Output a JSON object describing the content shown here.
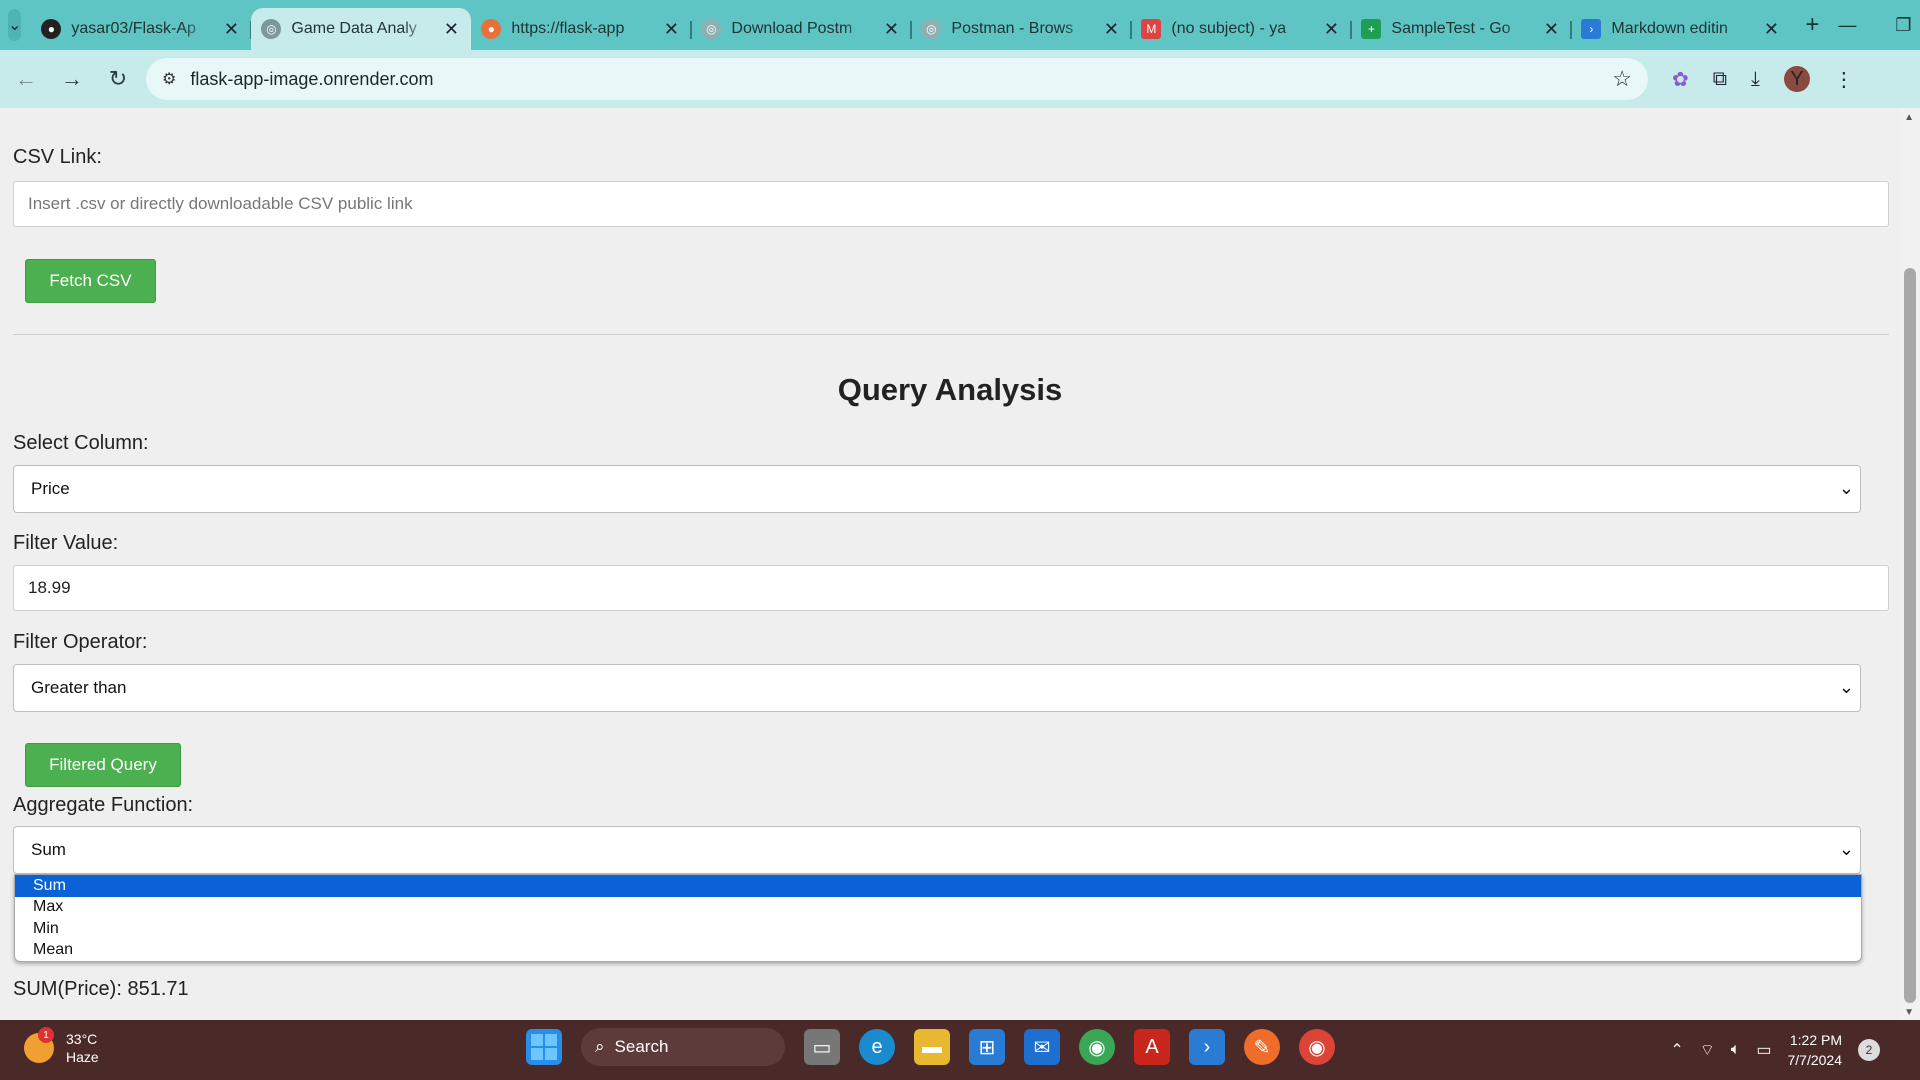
{
  "browser": {
    "tabs": [
      {
        "label": "yasar03/Flask-Ap",
        "icon": "github-icon",
        "active": false
      },
      {
        "label": "Game Data Analy",
        "icon": "globe-icon",
        "active": true
      },
      {
        "label": "https://flask-app",
        "icon": "render-icon",
        "active": false
      },
      {
        "label": "Download Postm",
        "icon": "postman-icon",
        "active": false
      },
      {
        "label": "Postman - Brows",
        "icon": "postman-icon",
        "active": false
      },
      {
        "label": "(no subject) - ya",
        "icon": "gmail-icon",
        "active": false
      },
      {
        "label": "SampleTest - Go",
        "icon": "sheets-icon",
        "active": false
      },
      {
        "label": "Markdown editin",
        "icon": "vscode-icon",
        "active": false
      }
    ],
    "url": "flask-app-image.onrender.com",
    "profile_initial": "Y"
  },
  "page": {
    "csv_label": "CSV Link:",
    "csv_placeholder": "Insert .csv or directly downloadable CSV public link",
    "fetch_button": "Fetch CSV",
    "section_title": "Query Analysis",
    "select_column_label": "Select Column:",
    "select_column_value": "Price",
    "filter_value_label": "Filter Value:",
    "filter_value": "18.99",
    "filter_operator_label": "Filter Operator:",
    "filter_operator_value": "Greater than",
    "filtered_query_button": "Filtered Query",
    "aggregate_label": "Aggregate Function:",
    "aggregate_value": "Sum",
    "aggregate_options": [
      "Sum",
      "Max",
      "Min",
      "Mean"
    ],
    "result": "SUM(Price): 851.71"
  },
  "taskbar": {
    "weather_temp": "33°C",
    "weather_desc": "Haze",
    "weather_badge": "1",
    "search_label": "Search",
    "time": "1:22 PM",
    "date": "7/7/2024",
    "notifications": "2"
  }
}
